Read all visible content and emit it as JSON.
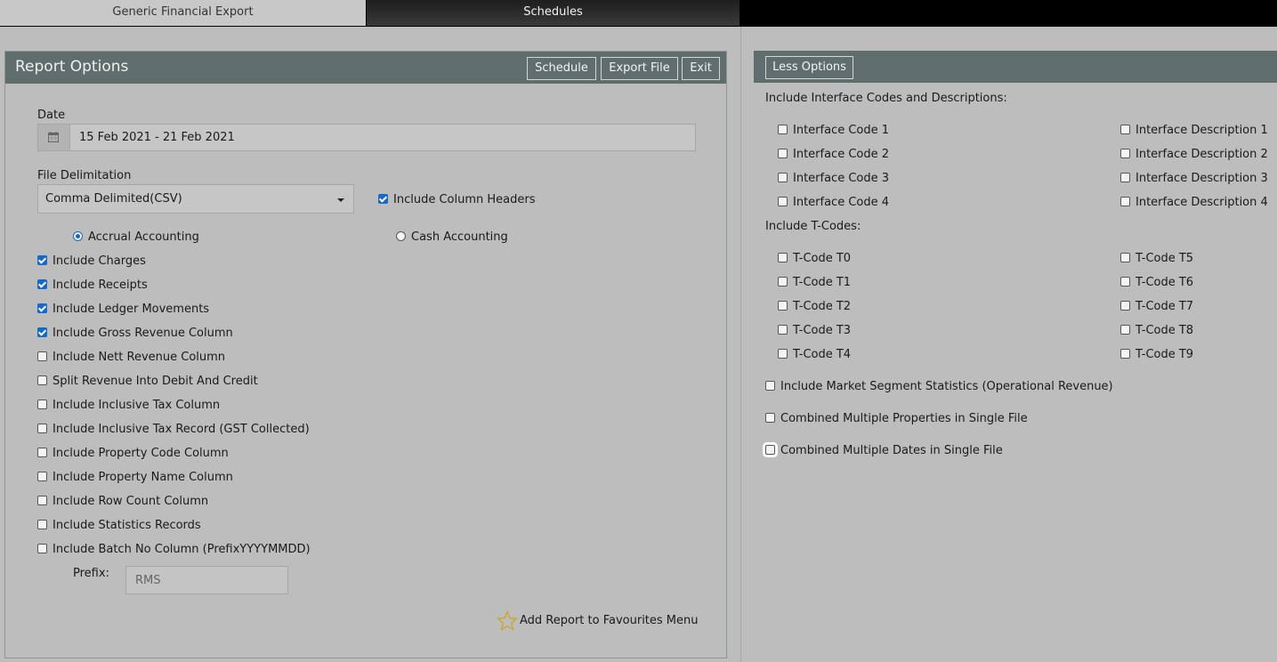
{
  "tabs": [
    {
      "label": "Generic Financial Export"
    },
    {
      "label": "Schedules"
    }
  ],
  "report_options": {
    "title": "Report Options",
    "buttons": {
      "schedule": "Schedule",
      "export_file": "Export File",
      "exit": "Exit"
    },
    "date": {
      "label": "Date",
      "value": "15 Feb 2021 - 21 Feb 2021",
      "icon": "calendar-icon"
    },
    "file_delimitation": {
      "label": "File Delimitation",
      "value": "Comma Delimited(CSV)"
    },
    "include_column_headers": {
      "label": "Include Column Headers",
      "checked": true
    },
    "accounting": {
      "accrual": {
        "label": "Accrual Accounting",
        "selected": true
      },
      "cash": {
        "label": "Cash Accounting",
        "selected": false
      }
    },
    "options": [
      {
        "label": "Include Charges",
        "checked": true
      },
      {
        "label": "Include Receipts",
        "checked": true
      },
      {
        "label": "Include Ledger Movements",
        "checked": true
      },
      {
        "label": "Include Gross Revenue Column",
        "checked": true
      },
      {
        "label": "Include Nett Revenue Column",
        "checked": false
      },
      {
        "label": "Split Revenue Into Debit And Credit",
        "checked": false
      },
      {
        "label": "Include Inclusive Tax Column",
        "checked": false
      },
      {
        "label": "Include Inclusive Tax Record (GST Collected)",
        "checked": false
      },
      {
        "label": "Include Property Code Column",
        "checked": false
      },
      {
        "label": "Include Property Name Column",
        "checked": false
      },
      {
        "label": "Include Row Count Column",
        "checked": false
      },
      {
        "label": "Include Statistics Records",
        "checked": false
      },
      {
        "label": "Include Batch No Column (PrefixYYYYMMDD)",
        "checked": false
      }
    ],
    "prefix": {
      "label": "Prefix:",
      "value": "RMS"
    },
    "favourites": {
      "label": "Add Report to Favourites Menu",
      "icon": "star-icon"
    }
  },
  "more_options": {
    "less_options_button": "Less Options",
    "interface_heading": "Include Interface Codes and Descriptions:",
    "interface_codes": [
      {
        "label": "Interface Code 1",
        "checked": false
      },
      {
        "label": "Interface Code 2",
        "checked": false
      },
      {
        "label": "Interface Code 3",
        "checked": false
      },
      {
        "label": "Interface Code 4",
        "checked": false
      }
    ],
    "interface_descriptions": [
      {
        "label": "Interface Description 1",
        "checked": false
      },
      {
        "label": "Interface Description 2",
        "checked": false
      },
      {
        "label": "Interface Description 3",
        "checked": false
      },
      {
        "label": "Interface Description 4",
        "checked": false
      }
    ],
    "tcodes_heading": "Include T-Codes:",
    "tcodes_left": [
      {
        "label": "T-Code T0",
        "checked": false
      },
      {
        "label": "T-Code T1",
        "checked": false
      },
      {
        "label": "T-Code T2",
        "checked": false
      },
      {
        "label": "T-Code T3",
        "checked": false
      },
      {
        "label": "T-Code T4",
        "checked": false
      }
    ],
    "tcodes_right": [
      {
        "label": "T-Code T5",
        "checked": false
      },
      {
        "label": "T-Code T6",
        "checked": false
      },
      {
        "label": "T-Code T7",
        "checked": false
      },
      {
        "label": "T-Code T8",
        "checked": false
      },
      {
        "label": "T-Code T9",
        "checked": false
      }
    ],
    "extras": [
      {
        "label": "Include Market Segment Statistics (Operational Revenue)",
        "checked": false
      },
      {
        "label": "Combined Multiple Properties in Single File",
        "checked": false
      },
      {
        "label": "Combined Multiple Dates in Single File",
        "checked": false
      }
    ]
  },
  "colors": {
    "header": "#5f6d6c",
    "background": "#bdbdbd",
    "checkbox_accent": "#1769c8"
  }
}
